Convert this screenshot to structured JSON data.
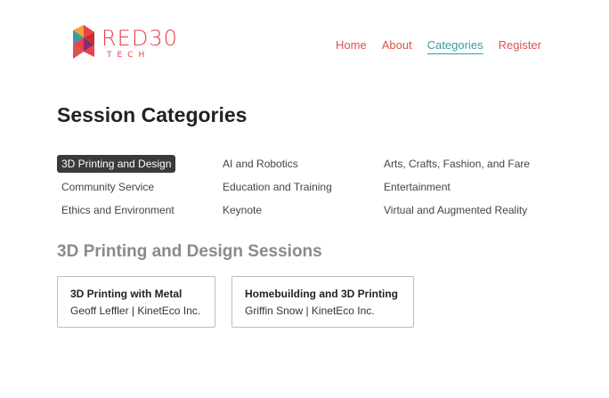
{
  "brand": {
    "name": "RED30",
    "sub": "TECH",
    "accent": "#e8424b"
  },
  "nav": [
    {
      "label": "Home",
      "active": false
    },
    {
      "label": "About",
      "active": false
    },
    {
      "label": "Categories",
      "active": true
    },
    {
      "label": "Register",
      "active": false
    }
  ],
  "page_title": "Session Categories",
  "categories": [
    [
      "3D Printing and Design",
      "AI and Robotics",
      "Arts, Crafts, Fashion, and Fare"
    ],
    [
      "Community Service",
      "Education and Training",
      "Entertainment"
    ],
    [
      "Ethics and Environment",
      "Keynote",
      "Virtual and Augmented Reality"
    ]
  ],
  "selected_category": "3D Printing and Design",
  "section_title": "3D Printing and Design Sessions",
  "sessions": [
    {
      "title": "3D Printing with Metal",
      "speaker": "Geoff Leffler | KinetEco Inc."
    },
    {
      "title": "Homebuilding and 3D Printing",
      "speaker": "Griffin Snow | KinetEco Inc."
    }
  ],
  "colors": {
    "link": "#d9534f",
    "active_link": "#3a9aa8",
    "selected_bg": "#3a3a3a"
  }
}
